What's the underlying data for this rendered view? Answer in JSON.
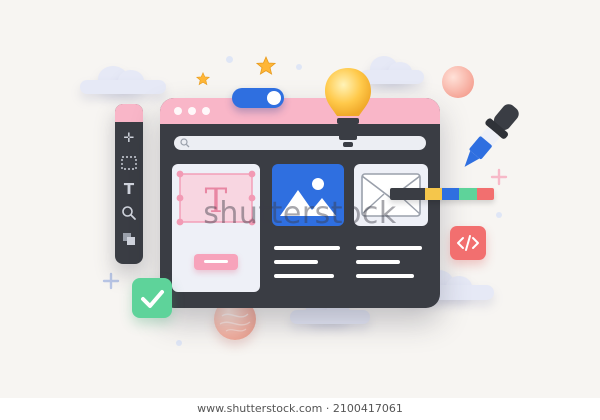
{
  "illustration": {
    "icons": {
      "lightbulb": "lightbulb-icon",
      "eyedropper": "eyedropper-icon",
      "code": "code-icon",
      "checkmark": "checkmark-icon",
      "image": "image-icon",
      "envelope": "envelope-icon",
      "text_tool": "text-tool-icon"
    },
    "colors": {
      "window_dark": "#3a3d44",
      "window_pink": "#f9b6c8",
      "accent_blue": "#2f6fe0",
      "code_badge": "#f26f6f",
      "check_badge": "#5ed39a",
      "bulb_yellow": "#ffc94a",
      "background": "#f7f5f2"
    }
  },
  "watermark": {
    "text": "shutterstock"
  },
  "footer": {
    "url": "www.shutterstock.com · 2100417061"
  }
}
